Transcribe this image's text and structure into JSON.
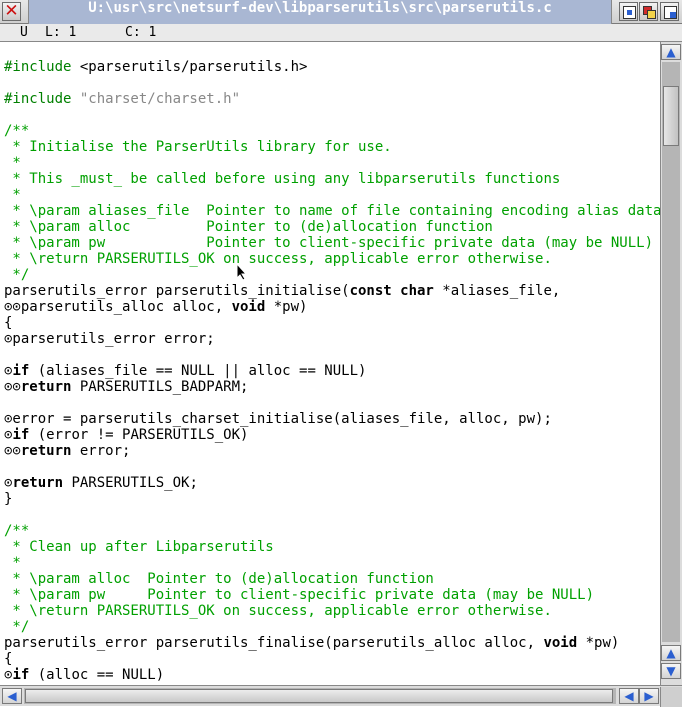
{
  "window": {
    "title": "U:\\usr\\src\\netsurf-dev\\libparserutils\\src\\parserutils.c"
  },
  "status": {
    "mode": "U",
    "line": "L: 1",
    "column": "C: 1"
  },
  "code_lines": [
    {
      "n": 0,
      "segments": [
        {
          "t": "#include ",
          "c": "pp"
        },
        {
          "t": "<parserutils/parserutils.h>",
          "c": "tab"
        }
      ]
    },
    {
      "n": 2,
      "segments": [
        {
          "t": "#include ",
          "c": "pp"
        },
        {
          "t": "\"charset/charset.h\"",
          "c": "str"
        }
      ]
    },
    {
      "n": 4,
      "segments": [
        {
          "t": "/**",
          "c": "cm"
        }
      ]
    },
    {
      "n": 5,
      "segments": [
        {
          "t": " * Initialise the ParserUtils library for use.",
          "c": "cm"
        }
      ]
    },
    {
      "n": 6,
      "segments": [
        {
          "t": " *",
          "c": "cm"
        }
      ]
    },
    {
      "n": 7,
      "segments": [
        {
          "t": " * This _must_ be called before using any libparserutils functions",
          "c": "cm"
        }
      ]
    },
    {
      "n": 8,
      "segments": [
        {
          "t": " *",
          "c": "cm"
        }
      ]
    },
    {
      "n": 9,
      "segments": [
        {
          "t": " * \\param aliases_file  Pointer to name of file containing encoding alias data",
          "c": "cm"
        }
      ]
    },
    {
      "n": 10,
      "segments": [
        {
          "t": " * \\param alloc         Pointer to (de)allocation function",
          "c": "cm"
        }
      ]
    },
    {
      "n": 11,
      "segments": [
        {
          "t": " * \\param pw            Pointer to client-specific private data (may be NULL)",
          "c": "cm"
        }
      ]
    },
    {
      "n": 12,
      "segments": [
        {
          "t": " * \\return PARSERUTILS_OK on success, applicable error otherwise.",
          "c": "cm"
        }
      ]
    },
    {
      "n": 13,
      "segments": [
        {
          "t": " */",
          "c": "cm"
        }
      ]
    },
    {
      "n": 14,
      "segments": [
        {
          "t": "parserutils_error parserutils_initialise(",
          "c": "tab"
        },
        {
          "t": "const char",
          "c": "kw"
        },
        {
          "t": " *aliases_file,",
          "c": "tab"
        }
      ]
    },
    {
      "n": 15,
      "segments": [
        {
          "t": "⊙⊙parserutils_alloc alloc, ",
          "c": "tab"
        },
        {
          "t": "void",
          "c": "kw"
        },
        {
          "t": " *pw)",
          "c": "tab"
        }
      ]
    },
    {
      "n": 16,
      "segments": [
        {
          "t": "{",
          "c": "tab"
        }
      ]
    },
    {
      "n": 17,
      "segments": [
        {
          "t": "⊙parserutils_error error;",
          "c": "tab"
        }
      ]
    },
    {
      "n": 19,
      "segments": [
        {
          "t": "⊙",
          "c": "tab"
        },
        {
          "t": "if",
          "c": "kw"
        },
        {
          "t": " (aliases_file == NULL || alloc == NULL)",
          "c": "tab"
        }
      ]
    },
    {
      "n": 20,
      "segments": [
        {
          "t": "⊙⊙",
          "c": "tab"
        },
        {
          "t": "return",
          "c": "kw"
        },
        {
          "t": " PARSERUTILS_BADPARM;",
          "c": "tab"
        }
      ]
    },
    {
      "n": 22,
      "segments": [
        {
          "t": "⊙error = parserutils_charset_initialise(aliases_file, alloc, pw);",
          "c": "tab"
        }
      ]
    },
    {
      "n": 23,
      "segments": [
        {
          "t": "⊙",
          "c": "tab"
        },
        {
          "t": "if",
          "c": "kw"
        },
        {
          "t": " (error != PARSERUTILS_OK)",
          "c": "tab"
        }
      ]
    },
    {
      "n": 24,
      "segments": [
        {
          "t": "⊙⊙",
          "c": "tab"
        },
        {
          "t": "return",
          "c": "kw"
        },
        {
          "t": " error;",
          "c": "tab"
        }
      ]
    },
    {
      "n": 26,
      "segments": [
        {
          "t": "⊙",
          "c": "tab"
        },
        {
          "t": "return",
          "c": "kw"
        },
        {
          "t": " PARSERUTILS_OK;",
          "c": "tab"
        }
      ]
    },
    {
      "n": 27,
      "segments": [
        {
          "t": "}",
          "c": "tab"
        }
      ]
    },
    {
      "n": 29,
      "segments": [
        {
          "t": "/**",
          "c": "cm"
        }
      ]
    },
    {
      "n": 30,
      "segments": [
        {
          "t": " * Clean up after Libparserutils",
          "c": "cm"
        }
      ]
    },
    {
      "n": 31,
      "segments": [
        {
          "t": " *",
          "c": "cm"
        }
      ]
    },
    {
      "n": 32,
      "segments": [
        {
          "t": " * \\param alloc  Pointer to (de)allocation function",
          "c": "cm"
        }
      ]
    },
    {
      "n": 33,
      "segments": [
        {
          "t": " * \\param pw     Pointer to client-specific private data (may be NULL)",
          "c": "cm"
        }
      ]
    },
    {
      "n": 34,
      "segments": [
        {
          "t": " * \\return PARSERUTILS_OK on success, applicable error otherwise.",
          "c": "cm"
        }
      ]
    },
    {
      "n": 35,
      "segments": [
        {
          "t": " */",
          "c": "cm"
        }
      ]
    },
    {
      "n": 36,
      "segments": [
        {
          "t": "parserutils_error parserutils_finalise(parserutils_alloc alloc, ",
          "c": "tab"
        },
        {
          "t": "void",
          "c": "kw"
        },
        {
          "t": " *pw)",
          "c": "tab"
        }
      ]
    },
    {
      "n": 37,
      "segments": [
        {
          "t": "{",
          "c": "tab"
        }
      ]
    },
    {
      "n": 38,
      "segments": [
        {
          "t": "⊙",
          "c": "tab"
        },
        {
          "t": "if",
          "c": "kw"
        },
        {
          "t": " (alloc == NULL)",
          "c": "tab"
        }
      ]
    }
  ],
  "icons": {
    "close": "close-icon",
    "iconize": "iconize-icon",
    "toggle_size": "toggle-size-icon",
    "resize": "resize-icon",
    "scroll_up": "arrow-up-icon",
    "scroll_down": "arrow-down-icon",
    "scroll_left": "arrow-left-icon",
    "scroll_right": "arrow-right-icon",
    "pointer": "mouse-pointer-icon"
  },
  "colors": {
    "title_bg": "#a9b7d3",
    "comment": "#00a000",
    "preprocessor": "#008000",
    "string": "#888888",
    "close": "#cc1111",
    "arrows": "#2b5fd0"
  }
}
